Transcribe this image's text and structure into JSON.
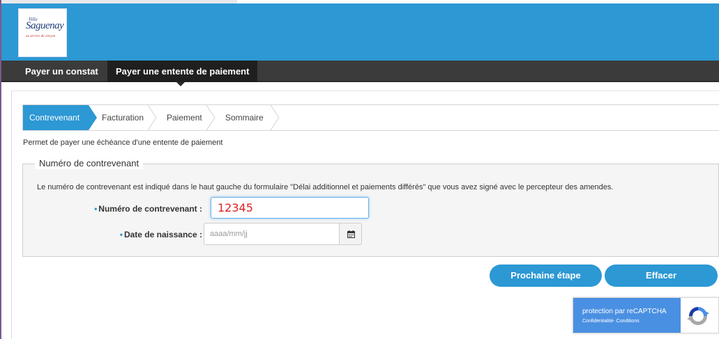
{
  "header": {
    "logo": {
      "ville": "Ville",
      "name": "Saguenay",
      "slogan": "au service du citoyen"
    }
  },
  "nav": {
    "items": [
      {
        "label": "Payer un constat"
      },
      {
        "label": "Payer une entente de paiement"
      }
    ]
  },
  "steps": [
    {
      "label": "Contrevenant",
      "active": true
    },
    {
      "label": "Facturation"
    },
    {
      "label": "Paiement"
    },
    {
      "label": "Sommaire"
    }
  ],
  "description": "Permet de payer une échéance d'une entente de paiement",
  "form": {
    "legend": "Numéro de contrevenant",
    "help": "Le numéro de contrevenant est indiqué dans le haut gauche du formulaire \"Délai additionnel et paiements différés\" que vous avez signé avec le percepteur des amendes.",
    "fields": {
      "numero": {
        "label": "Numéro de contrevenant :",
        "required_marker": "•",
        "value": "12345"
      },
      "date": {
        "label": "Date de naissance :",
        "required_marker": "•",
        "placeholder": "aaaa/mm/jj",
        "icon": "calendar-icon"
      }
    }
  },
  "buttons": {
    "next_label": "Prochaine étape",
    "clear_label": "Effacer"
  },
  "recaptcha": {
    "title": "protection par reCAPTCHA",
    "links": "Confidentialité- Conditions",
    "icon": "recaptcha-icon"
  },
  "colors": {
    "accent": "#2c98d4",
    "nav": "#3b3b3b",
    "recaptcha": "#4a90e2"
  }
}
